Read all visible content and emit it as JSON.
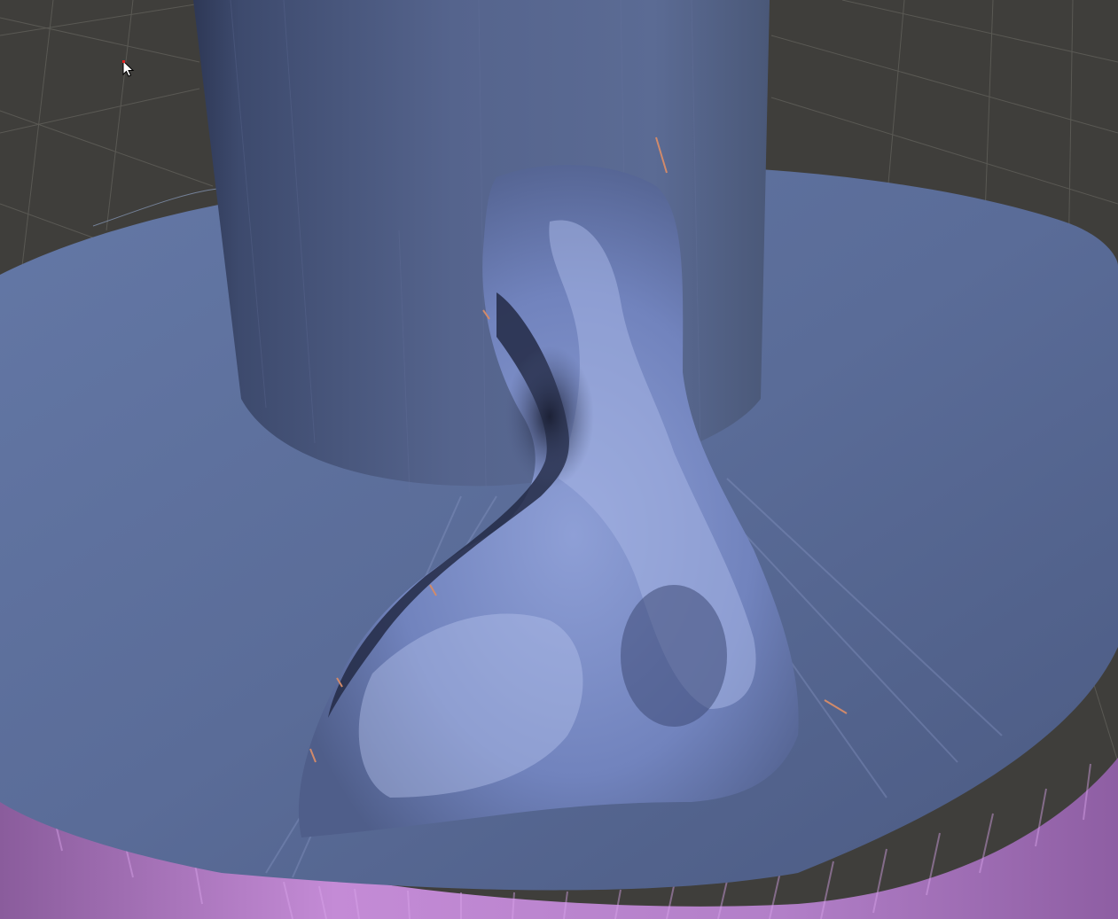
{
  "app": {
    "view": "3d-viewport",
    "tool_cursor": "arrow-cursor-icon"
  },
  "colors": {
    "background": "#3f3e3b",
    "grid_line": "#5a5954",
    "mesh_top": "#5f6f98",
    "mesh_shadow": "#3a4564",
    "mesh_highlight": "#aab7e6",
    "rim_side": "#b585cc",
    "artifact": "#d18a6a"
  },
  "labels": {}
}
